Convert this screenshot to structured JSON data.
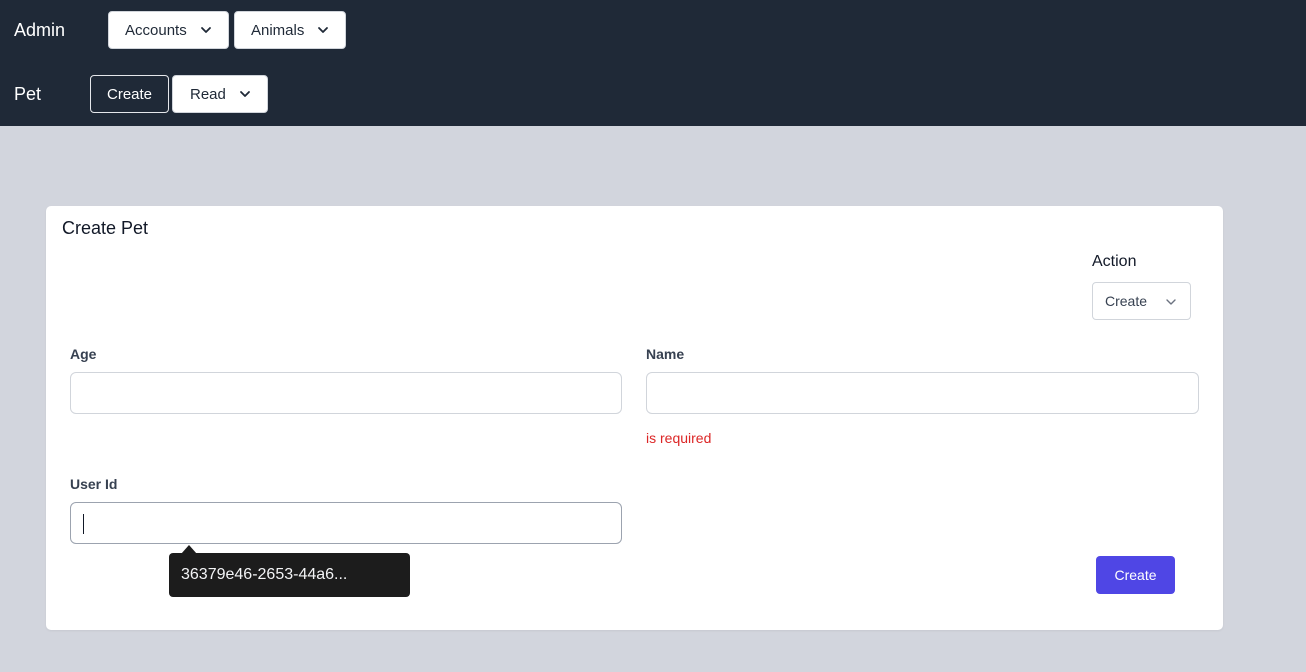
{
  "nav": {
    "admin_label": "Admin",
    "accounts_label": "Accounts",
    "animals_label": "Animals",
    "pet_label": "Pet",
    "create_label": "Create",
    "read_label": "Read"
  },
  "form": {
    "title": "Create Pet",
    "action_label": "Action",
    "action_value": "Create",
    "fields": {
      "age": {
        "label": "Age",
        "value": ""
      },
      "name": {
        "label": "Name",
        "value": "",
        "error": "is required"
      },
      "user_id": {
        "label": "User Id",
        "value": ""
      }
    },
    "submit_label": "Create"
  },
  "tooltip": {
    "text": "36379e46-2653-44a6..."
  },
  "colors": {
    "nav_bg": "#1f2937",
    "page_bg": "#d2d5dd",
    "primary": "#4f46e5",
    "error": "#dc2626"
  }
}
